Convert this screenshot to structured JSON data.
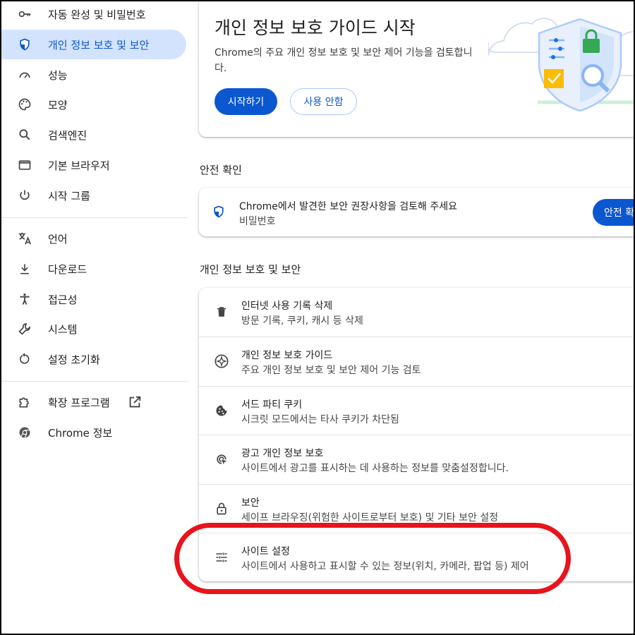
{
  "sidebar": {
    "items": [
      {
        "label": "자동 완성 및 비밀번호",
        "icon": "key-icon"
      },
      {
        "label": "개인 정보 보호 및 보안",
        "icon": "shield-icon",
        "active": true
      },
      {
        "label": "성능",
        "icon": "speedometer-icon"
      },
      {
        "label": "모양",
        "icon": "palette-icon"
      },
      {
        "label": "검색엔진",
        "icon": "search-icon"
      },
      {
        "label": "기본 브라우저",
        "icon": "browser-window-icon"
      },
      {
        "label": "시작 그룹",
        "icon": "power-icon"
      },
      {
        "label": "언어",
        "icon": "translate-icon"
      },
      {
        "label": "다운로드",
        "icon": "download-icon"
      },
      {
        "label": "접근성",
        "icon": "accessibility-icon"
      },
      {
        "label": "시스템",
        "icon": "wrench-icon"
      },
      {
        "label": "설정 초기화",
        "icon": "reset-icon"
      },
      {
        "label": "확장 프로그램",
        "icon": "extension-icon"
      },
      {
        "label": "Chrome 정보",
        "icon": "chrome-icon"
      }
    ]
  },
  "guide": {
    "title": "개인 정보 보호 가이드 시작",
    "description": "Chrome의 주요 개인 정보 보호 및 보안 제어 기능을 검토합니다.",
    "start_label": "시작하기",
    "skip_label": "사용 안함"
  },
  "safety": {
    "section_title": "안전 확인",
    "message": "Chrome에서 발견한 보안 권장사항을 검토해 주세요",
    "sub": "비밀번호",
    "button_label": "안전 확인"
  },
  "privacy": {
    "section_title": "개인 정보 보호 및 보안",
    "rows": [
      {
        "title": "인터넷 사용 기록 삭제",
        "subtitle": "방문 기록, 쿠키, 캐시 등 삭제",
        "icon": "trash-icon"
      },
      {
        "title": "개인 정보 보호 가이드",
        "subtitle": "주요 개인 정보 보호 및 보안 제어 기능 검토",
        "icon": "privacy-guide-icon"
      },
      {
        "title": "서드 파티 쿠키",
        "subtitle": "시크릿 모드에서는 타사 쿠키가 차단됨",
        "icon": "cookie-icon"
      },
      {
        "title": "광고 개인 정보 보호",
        "subtitle": "사이트에서 광고를 표시하는 데 사용하는 정보를 맞춤설정합니다.",
        "icon": "ad-privacy-icon"
      },
      {
        "title": "보안",
        "subtitle": "세이프 브라우징(위험한 사이트로부터 보호) 및 기타 보안 설정",
        "icon": "lock-icon"
      },
      {
        "title": "사이트 설정",
        "subtitle": "사이트에서 사용하고 표시할 수 있는 정보(위치, 카메라, 팝업 등) 제어",
        "icon": "tune-icon"
      }
    ]
  },
  "colors": {
    "accent": "#0b57d0",
    "active_bg": "#d3e3fd",
    "highlight": "#e8141c"
  }
}
